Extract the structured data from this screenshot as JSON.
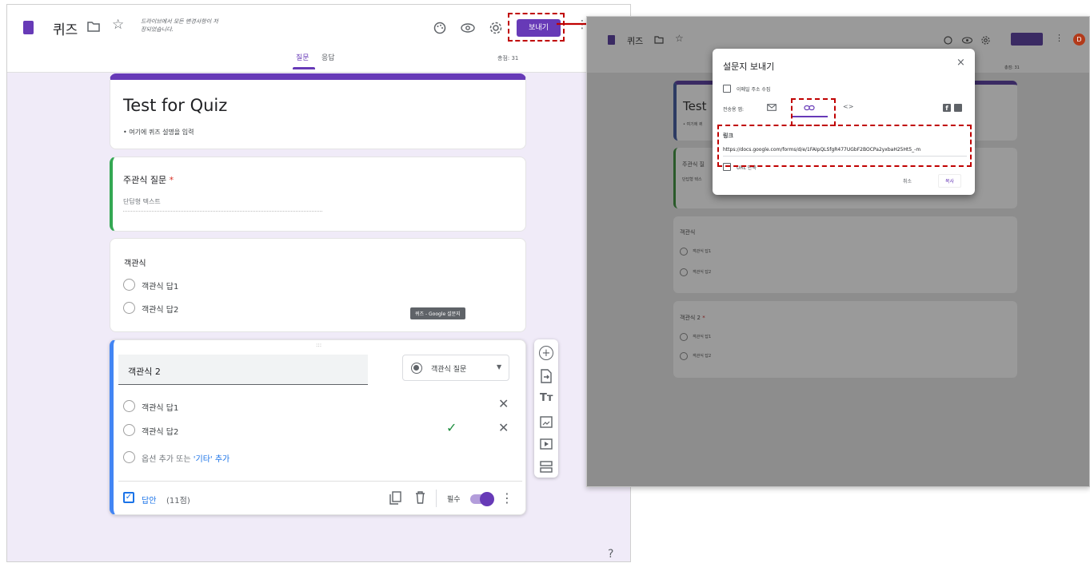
{
  "editor": {
    "title": "퀴즈",
    "save_notice": "드라이브에서 모든 변경사항이 저장되었습니다.",
    "send_label": "보내기",
    "tabs": [
      "질문",
      "응답"
    ],
    "total_score": "총점: 31",
    "form_title": "Test for Quiz",
    "form_desc": "• 여기에 퀴즈 설명을 입력",
    "q1": {
      "title": "주관식 질문",
      "required_mark": "*",
      "placeholder": "단답형 텍스트"
    },
    "q2": {
      "title": "객관식",
      "options": [
        "객관식 답1",
        "객관식 답2"
      ],
      "tooltip": "퀴즈 - Google 설문지"
    },
    "q3": {
      "title": "객관식 2",
      "type": "객관식 질문",
      "options": [
        "객관식 답1",
        "객관식 답2"
      ],
      "add_option": "옵션 추가 또는",
      "add_other": "'기타' 추가",
      "answer_key": "답안",
      "points": "(11점)",
      "required": "필수"
    }
  },
  "preview": {
    "title": "퀴즈",
    "total_score": "총점: 31",
    "form_title": "Test",
    "form_desc": "• 여기에 퀴",
    "q1": {
      "title": "주관식 질",
      "placeholder": "단답형 텍스"
    },
    "q2": {
      "title": "객관식",
      "options": [
        "객관식 답1",
        "객관식 답2"
      ]
    },
    "q3": {
      "title": "객관식 2",
      "required_mark": "*",
      "options": [
        "객관식 답1",
        "객관식 답2"
      ]
    },
    "avatar": "D"
  },
  "dialog": {
    "title": "설문지 보내기",
    "close": "×",
    "collect_email": "이메일 주소 수집",
    "send_via": "전송용 앱:",
    "link_label": "링크",
    "link_url": "https://docs.google.com/forms/d/e/1FAIpQLSfgR477UGbF2BOCPa2yxbaH25Ht5_-m",
    "shorten": "URL 단축",
    "cancel": "취소",
    "copy": "복사"
  },
  "colors": {
    "accent": "#673ab7",
    "highlight": "#c00000",
    "toggle": "#673ab7"
  }
}
